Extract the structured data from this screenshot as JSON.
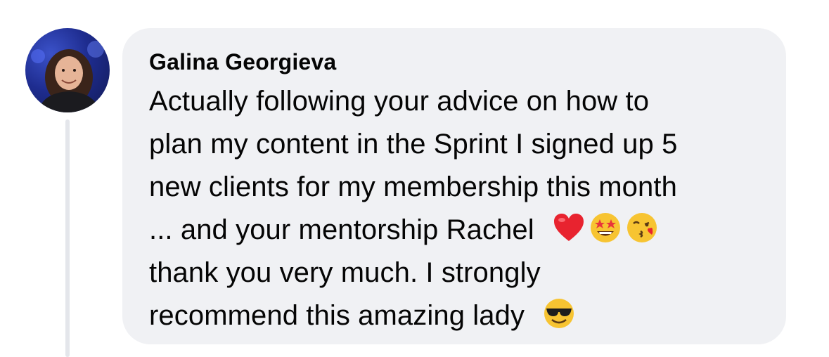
{
  "comment": {
    "author": "Galina Georgieva",
    "avatar_icon": "user-avatar",
    "lines": [
      "Actually following your advice on how to",
      "plan my content in the Sprint I signed up 5",
      "new clients for my membership this month",
      "... and your mentorship Rachel",
      "thank you very much. I strongly",
      "recommend this amazing lady"
    ],
    "emojis": {
      "line4": [
        "red-heart-icon",
        "star-struck-icon",
        "face-blowing-kiss-icon"
      ],
      "line6": [
        "smiling-face-with-sunglasses-icon"
      ]
    },
    "colors": {
      "bubble": "#f0f1f4",
      "text": "#050505",
      "thread_line": "#e4e6eb"
    }
  }
}
